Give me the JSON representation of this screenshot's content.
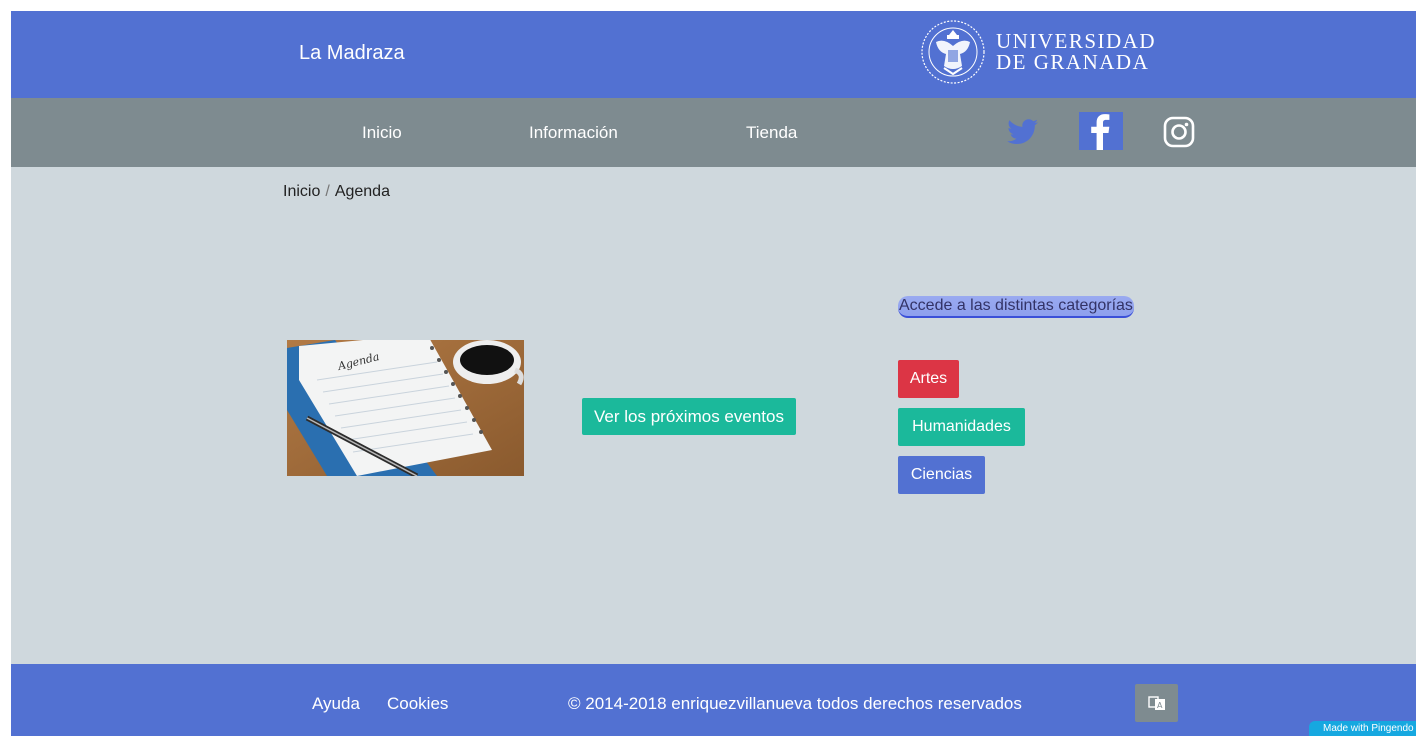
{
  "header": {
    "site_title": "La Madraza",
    "university_line1": "UNIVERSIDAD",
    "university_line2": "DE GRANADA"
  },
  "nav": {
    "items": [
      {
        "label": "Inicio"
      },
      {
        "label": "Información"
      },
      {
        "label": "Tienda"
      }
    ],
    "social": [
      "twitter-icon",
      "facebook-icon",
      "instagram-icon"
    ]
  },
  "breadcrumb": {
    "home": "Inicio",
    "separator": "/",
    "current": "Agenda"
  },
  "main": {
    "events_button": "Ver los próximos eventos",
    "categories_label": "Accede a las distintas categorías",
    "categories": [
      {
        "label": "Artes",
        "color": "#dc3545"
      },
      {
        "label": "Humanidades",
        "color": "#1bb99b"
      },
      {
        "label": "Ciencias",
        "color": "#5271d2"
      }
    ],
    "image_handwriting": "Agenda"
  },
  "footer": {
    "links": [
      "Ayuda",
      "Cookies"
    ],
    "copyright": "© 2014-2018 enriquezvillanueva todos derechos reservados",
    "language_icon": "translate-icon"
  },
  "badge": "Made with Pingendo",
  "colors": {
    "primary": "#5271d2",
    "nav_gray": "#7e8b90",
    "content_bg": "#cfd8dd",
    "accent_teal": "#1bb99b",
    "accent_red": "#dc3545"
  }
}
